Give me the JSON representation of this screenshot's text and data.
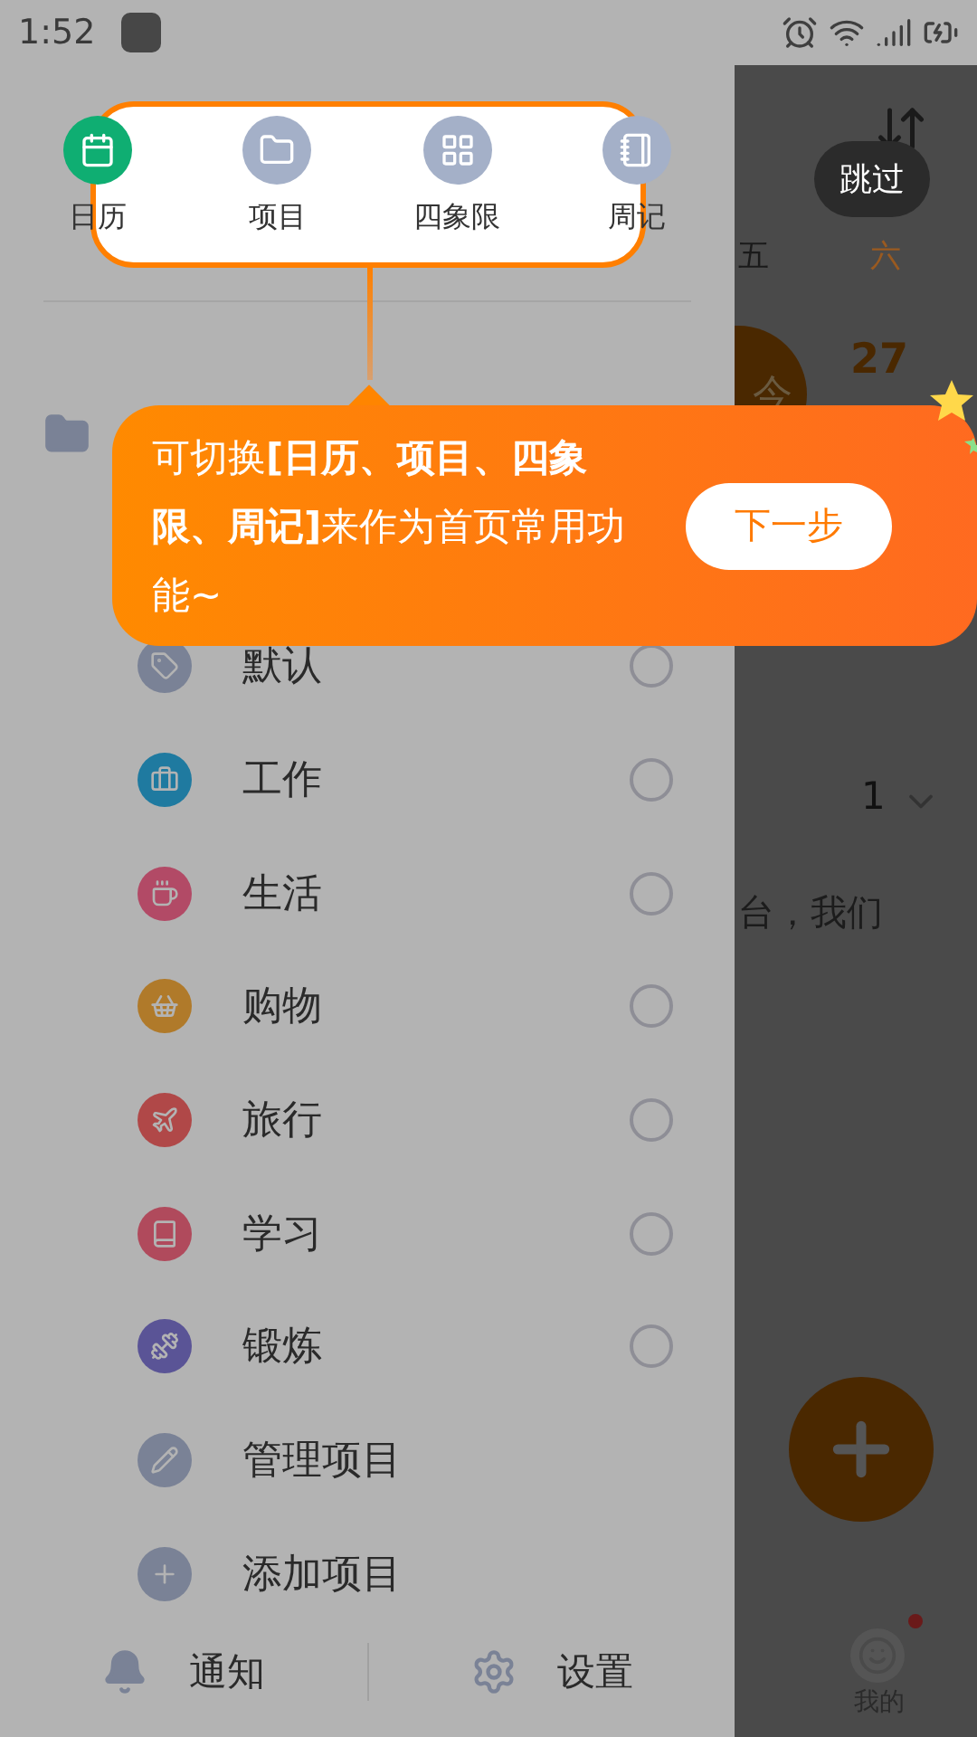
{
  "status_bar": {
    "time": "1:52"
  },
  "drawer": {
    "views": [
      {
        "label": "日历",
        "selected": true
      },
      {
        "label": "项目",
        "selected": false
      },
      {
        "label": "四象限",
        "selected": false
      },
      {
        "label": "周记",
        "selected": false
      }
    ],
    "projects": [
      {
        "label": "默认",
        "kind": "project",
        "color": "#7a8296",
        "checked": false
      },
      {
        "label": "工作",
        "kind": "project",
        "color": "#1f7aa0",
        "checked": false
      },
      {
        "label": "生活",
        "kind": "project",
        "color": "#b24a66",
        "checked": false
      },
      {
        "label": "购物",
        "kind": "project",
        "color": "#b07a2a",
        "checked": false
      },
      {
        "label": "旅行",
        "kind": "project",
        "color": "#b04848",
        "checked": false
      },
      {
        "label": "学习",
        "kind": "project",
        "color": "#b04a5c",
        "checked": false
      },
      {
        "label": "锻炼",
        "kind": "project",
        "color": "#5a5496",
        "checked": false
      },
      {
        "label": "管理项目",
        "kind": "action"
      },
      {
        "label": "添加项目",
        "kind": "action"
      }
    ],
    "footer": [
      {
        "label": "通知",
        "kind": "notify"
      },
      {
        "label": "设置",
        "kind": "settings"
      }
    ]
  },
  "tooltip": {
    "text": "可切换**[日历、项目、四象限、周记]**来作为首页常用功能~",
    "button": "下一步"
  },
  "background": {
    "skip": "跳过",
    "weekdays": [
      "五",
      "六"
    ],
    "today": "今",
    "date": "27",
    "count": "1",
    "snippet": "台，我们",
    "tab": "我的"
  }
}
